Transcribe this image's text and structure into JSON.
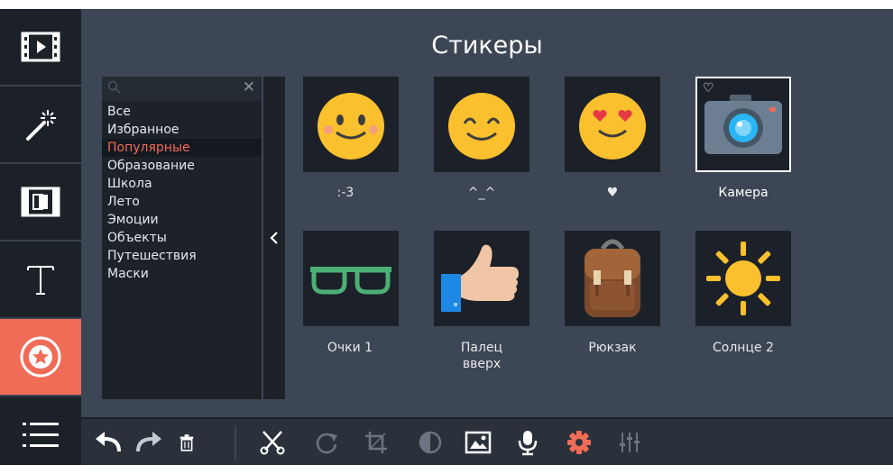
{
  "panel": {
    "title": "Стикеры"
  },
  "search": {
    "placeholder": ""
  },
  "categories": [
    {
      "label": "Все"
    },
    {
      "label": "Избранное"
    },
    {
      "label": "Популярные"
    },
    {
      "label": "Образование"
    },
    {
      "label": "Школа"
    },
    {
      "label": "Лето"
    },
    {
      "label": "Эмоции"
    },
    {
      "label": "Объекты"
    },
    {
      "label": "Путешествия"
    },
    {
      "label": "Маски"
    }
  ],
  "selected_category": "Популярные",
  "stickers": [
    {
      "label": ":-3",
      "icon": "smiley-blush-icon"
    },
    {
      "label": "^_^",
      "icon": "smiley-happy-icon"
    },
    {
      "label": "♥",
      "icon": "smiley-heart-eyes-icon"
    },
    {
      "label": "Камера",
      "icon": "camera-icon",
      "favorite_icon": "♡"
    },
    {
      "label": "Очки 1",
      "icon": "glasses-icon"
    },
    {
      "label": "Палец\nвверх",
      "label_line1": "Палец",
      "label_line2": "вверх",
      "icon": "thumbs-up-icon"
    },
    {
      "label": "Рюкзак",
      "icon": "backpack-icon"
    },
    {
      "label": "Солнце 2",
      "icon": "sun-icon"
    }
  ],
  "sidebar": [
    {
      "icon": "film-icon"
    },
    {
      "icon": "magic-wand-icon"
    },
    {
      "icon": "transitions-icon"
    },
    {
      "icon": "text-icon"
    },
    {
      "icon": "sticker-icon",
      "active": true
    },
    {
      "icon": "more-menu-icon"
    }
  ],
  "toolbar": [
    {
      "icon": "undo-icon"
    },
    {
      "icon": "redo-icon"
    },
    {
      "icon": "delete-icon"
    },
    {
      "icon": "cut-icon"
    },
    {
      "icon": "rotate-icon"
    },
    {
      "icon": "crop-icon"
    },
    {
      "icon": "color-adjust-icon"
    },
    {
      "icon": "image-icon"
    },
    {
      "icon": "microphone-icon"
    },
    {
      "icon": "settings-gear-icon"
    },
    {
      "icon": "equalizer-icon"
    }
  ],
  "colors": {
    "accent": "#f06c57",
    "background": "#3d4654",
    "sidebar": "#1c2128",
    "emoji_yellow": "#fbc02d"
  }
}
